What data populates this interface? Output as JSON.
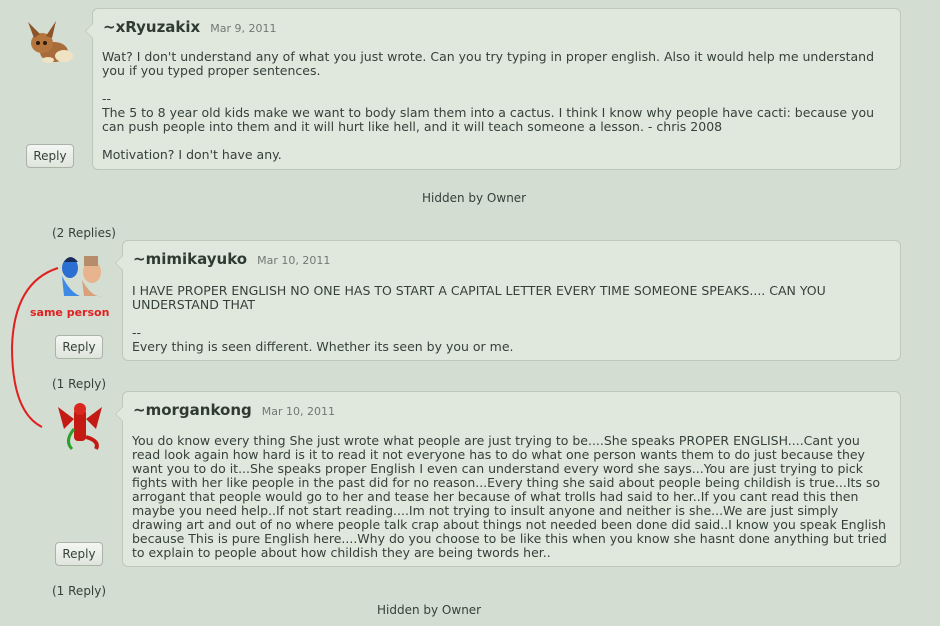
{
  "comments": [
    {
      "username": "~xRyuzakix",
      "date": "Mar 9, 2011",
      "paragraphs": [
        "Wat? I don't understand any of what you just wrote. Can you try typing in proper english. Also it would help me understand you if you typed proper sentences.",
        "--\nThe 5 to 8 year old kids make we want to body slam them into a cactus. I think I know why people have cacti: because you can push people into them and it will hurt like hell, and it will teach someone a lesson. - chris 2008",
        "Motivation? I don't have any."
      ],
      "reply_label": "Reply",
      "avatar_icon": "eevee-avatar-icon"
    },
    {
      "username": "~mimikayuko",
      "date": "Mar 10, 2011",
      "paragraphs": [
        "I HAVE PROPER ENGLISH NO ONE HAS TO START A CAPITAL LETTER EVERY TIME SOMEONE SPEAKS.... CAN YOU UNDERSTAND THAT",
        "--\nEvery thing is seen different. Whether its seen by you or me."
      ],
      "reply_label": "Reply",
      "avatar_icon": "couple-avatar-icon"
    },
    {
      "username": "~morgankong",
      "date": "Mar 10, 2011",
      "paragraphs": [
        "You do know every thing She just wrote what people are just trying to be....She speaks PROPER ENGLISH....Cant you read look again how hard is it to read it not everyone has to do what one person wants them to do just because they want you to do it...She speaks proper English I even can understand every word she says...You are just trying to pick fights with her like people in the past did for no reason...Every thing she said about people being childish is true...Its so arrogant that people would go to her and tease her because of what trolls had said to her..If you cant read this then maybe you need help..If not start reading....Im not trying to insult anyone and neither is she...We are just simply drawing art and out of no where people talk crap about things not needed been done did said..I know you speak English because This is pure English here....Why do you choose to be like this when you know she hasnt done anything but tried to explain to people about how childish they are being twords her.."
      ],
      "reply_label": "Reply",
      "avatar_icon": "red-dragon-avatar-icon"
    }
  ],
  "hidden_1": "Hidden by Owner",
  "hidden_2": "Hidden by Owner",
  "reply_count_1": "(2 Replies)",
  "reply_count_2": "(1 Reply)",
  "reply_count_3": "(1 Reply)",
  "annotation": {
    "text": "same person",
    "color": "#e02020"
  },
  "colors": {
    "background": "#d3ddd1",
    "bubble": "#e0e8de",
    "bubble_border": "#bcc8ba"
  }
}
